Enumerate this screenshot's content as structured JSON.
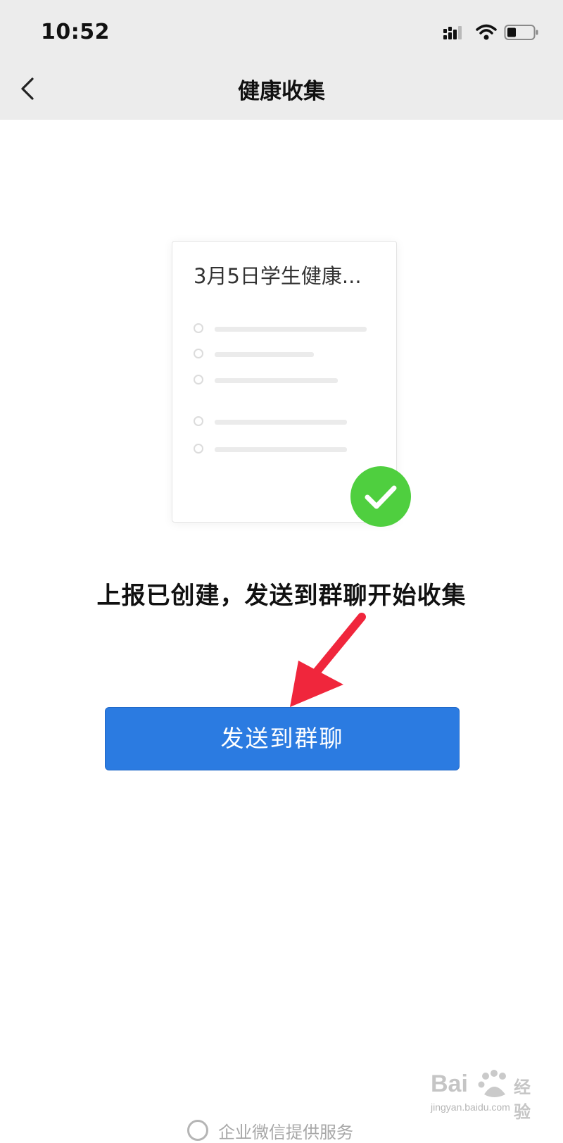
{
  "status_bar": {
    "time": "10:52"
  },
  "nav": {
    "title": "健康收集",
    "back_icon": "chevron-left-icon"
  },
  "card": {
    "title": "3月5日学生健康..."
  },
  "message": "上报已创建，发送到群聊开始收集",
  "send_button": {
    "label": "发送到群聊",
    "color": "#2b7be1"
  },
  "footer": {
    "text": "企业微信提供服务"
  },
  "watermark": {
    "brand": "Bai",
    "brand_cn": "经验",
    "url": "jingyan.baidu.com"
  },
  "colors": {
    "check": "#4fcf3f",
    "annotation_arrow": "#f0263c"
  }
}
